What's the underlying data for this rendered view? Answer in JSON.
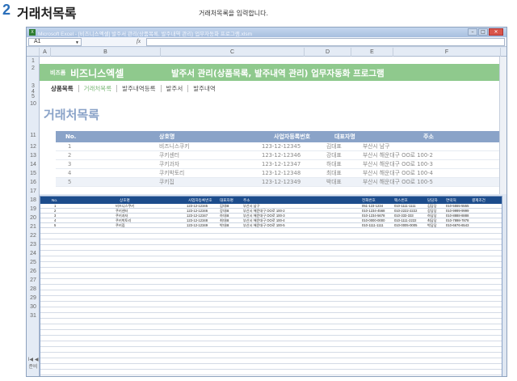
{
  "header": {
    "number": "2",
    "title": "거래처목록",
    "caption": "거래처목록을 입력합니다."
  },
  "window": {
    "title": "Microsoft Excel - [비즈니스엑셀] 발주서 관리(상품목록, 발주내역 관리) 업무자동화 프로그램.xlsm",
    "app_icon": "excel-icon"
  },
  "formula_bar": {
    "namebox": "A1",
    "fx": "fx"
  },
  "columns": [
    "A",
    "B",
    "C",
    "D",
    "E",
    "F"
  ],
  "rows": [
    "1",
    "2",
    "3",
    "4",
    "5",
    "10",
    "11",
    "12",
    "13",
    "14",
    "15",
    "16",
    "17",
    "18",
    "19",
    "20",
    "21",
    "22",
    "23",
    "24",
    "25",
    "26",
    "27",
    "28",
    "29",
    "30",
    "31"
  ],
  "bottom": {
    "nav": "I◀ ◀",
    "status": "준비"
  },
  "sheet": {
    "banner_small": "비즈폼",
    "banner_brand": "비즈니스엑셀",
    "banner_title": "발주서 관리(상품목록, 발주내역 관리) 업무자동화 프로그램",
    "nav": [
      "상품목록",
      "거래처목록",
      "발주내역등록",
      "발주서",
      "발주내역"
    ],
    "title": "거래처목록",
    "table": {
      "headers": [
        "No.",
        "상호명",
        "사업자등록번호",
        "대표자명",
        "주소"
      ],
      "rows": [
        [
          "1",
          "비즈니스쿠키",
          "123-12-12345",
          "김대표",
          "부산시 남구"
        ],
        [
          "2",
          "쿠키센터",
          "123-12-12346",
          "강대표",
          "부산시 해운대구 OO로 100-2"
        ],
        [
          "3",
          "쿠키과자",
          "123-12-12347",
          "하대표",
          "부산시 해운대구 OO로 100-3"
        ],
        [
          "4",
          "쿠키박토리",
          "123-12-12348",
          "최대표",
          "부산시 해운대구 OO로 100-4"
        ],
        [
          "5",
          "쿠키집",
          "123-12-12349",
          "박대표",
          "부산시 해운대구 OO로 100-5"
        ]
      ]
    }
  },
  "preview": {
    "headers": [
      "No.",
      "상호명",
      "사업자등록번호",
      "대표자명",
      "주소",
      "전화번호",
      "팩스번호",
      "담당자",
      "연락처",
      "결제조건"
    ],
    "rows": [
      [
        "1",
        "비즈니스쿠키",
        "123-12-12345",
        "김대표",
        "부산시 남구",
        "051-123-1234",
        "010-1111-1111",
        "김담당",
        "010-5555-5555",
        ""
      ],
      [
        "2",
        "쿠키센터",
        "123-12-12346",
        "강대표",
        "부산시 해운대구 OO로 100-2",
        "010-1234-4568",
        "010-2222-2222",
        "강담당",
        "010-9999-9999",
        ""
      ],
      [
        "3",
        "쿠키과자",
        "123-12-12347",
        "하대표",
        "부산시 해운대구 OO로 100-3",
        "010-1234-5678",
        "010-333-333",
        "하담당",
        "010-8888-8888",
        ""
      ],
      [
        "4",
        "쿠키박토리",
        "123-12-12348",
        "최대표",
        "부산시 해운대구 OO로 100-4",
        "010-0000-0000",
        "010-1111-2222",
        "최담당",
        "010-7898-7878",
        ""
      ],
      [
        "5",
        "쿠키집",
        "123-12-12349",
        "박대표",
        "부산시 해운대구 OO로 100-5",
        "010-1111-1111",
        "010-0005-0005",
        "박담당",
        "010-6676-6543",
        ""
      ]
    ]
  }
}
